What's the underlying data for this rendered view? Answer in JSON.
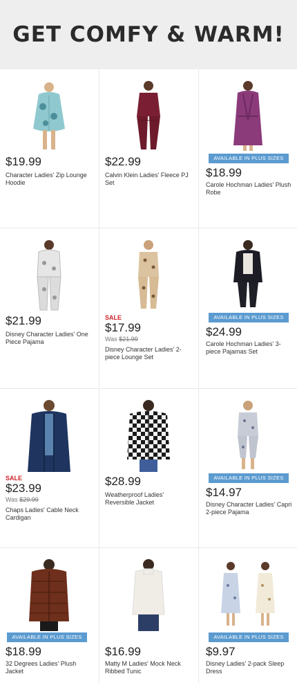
{
  "banner": {
    "title": "GET COMFY & WARM!"
  },
  "labels": {
    "plus_sizes": "AVAILABLE IN PLUS SIZES",
    "sale": "SALE",
    "was_prefix": "Was"
  },
  "colors": {
    "badge": "#5b9bd0",
    "sale": "#d0232a",
    "banner_bg": "#eeeeee"
  },
  "products": [
    {
      "price": "$19.99",
      "title": "Character Ladies' Zip Lounge Hoodie",
      "image": "teal-print-sleep-hoodie",
      "plus": false,
      "sale": false
    },
    {
      "price": "$22.99",
      "title": "Calvin Klein Ladies' Fleece PJ Set",
      "image": "burgundy-fleece-pj-set",
      "plus": false,
      "sale": false
    },
    {
      "price": "$18.99",
      "title": "Carole Hochman Ladies' Plush Robe",
      "image": "purple-plush-robe",
      "plus": true,
      "sale": false
    },
    {
      "price": "$21.99",
      "title": "Disney Character Ladies' One Piece Pajama",
      "image": "grey-character-onesie",
      "plus": false,
      "sale": false
    },
    {
      "price": "$17.99",
      "was": "$21.99",
      "title": "Disney Character Ladies' 2-piece Lounge Set",
      "image": "beige-print-lounge-set",
      "plus": false,
      "sale": true
    },
    {
      "price": "$24.99",
      "title": "Carole Hochman Ladies' 3-piece Pajamas Set",
      "image": "black-3-piece-pajamas",
      "plus": true,
      "sale": false
    },
    {
      "price": "$23.99",
      "was": "$29.99",
      "title": "Chaps Ladies' Cable Neck Cardigan",
      "image": "navy-cardigan",
      "plus": false,
      "sale": true
    },
    {
      "price": "$28.99",
      "title": "Weatherproof Ladies' Reversible Jacket",
      "image": "buffalo-check-jacket",
      "plus": false,
      "sale": false
    },
    {
      "price": "$14.97",
      "title": "Disney Character Ladies' Capri 2-piece Pajama",
      "image": "grey-capri-pajama",
      "plus": true,
      "sale": false
    },
    {
      "price": "$18.99",
      "title": "32 Degrees Ladies' Plush Jacket",
      "image": "brown-plush-jacket",
      "plus": true,
      "sale": false
    },
    {
      "price": "$16.99",
      "title": "Matty M Ladies' Mock Neck Ribbed Tunic",
      "image": "cream-mock-neck-tunic",
      "plus": false,
      "sale": false
    },
    {
      "price": "$9.97",
      "title": "Disney Ladies' 2-pack Sleep Dress",
      "image": "floral-sleep-dress-2pack",
      "plus": true,
      "sale": false
    }
  ]
}
